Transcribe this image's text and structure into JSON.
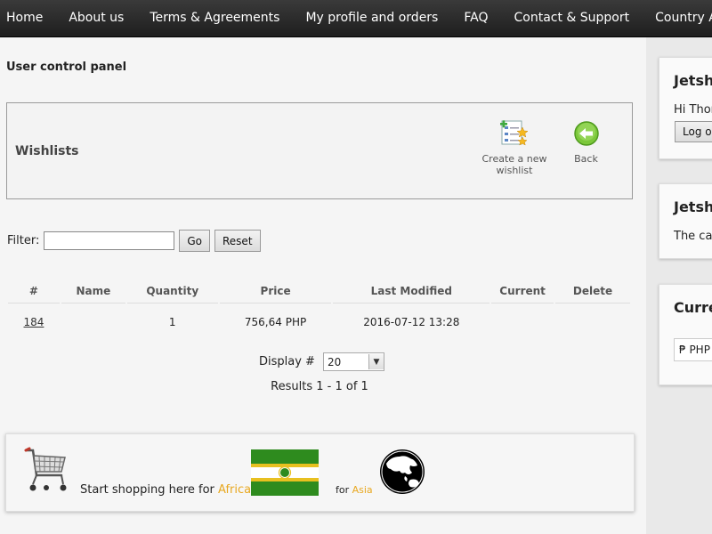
{
  "nav": {
    "items": [
      {
        "label": "Home"
      },
      {
        "label": "About us"
      },
      {
        "label": "Terms & Agreements"
      },
      {
        "label": "My profile and orders"
      },
      {
        "label": "FAQ"
      },
      {
        "label": "Contact & Support"
      },
      {
        "label": "Country Agents"
      }
    ]
  },
  "panel": {
    "title": "User control panel"
  },
  "wishlists": {
    "title": "Wishlists",
    "create_label": "Create a new wishlist",
    "back_label": "Back"
  },
  "filter": {
    "label": "Filter:",
    "value": "",
    "go_label": "Go",
    "reset_label": "Reset"
  },
  "table": {
    "headers": [
      "#",
      "Name",
      "Quantity",
      "Price",
      "Last Modified",
      "Current",
      "Delete"
    ],
    "rows": [
      {
        "id": "184",
        "name": "",
        "quantity": "1",
        "price": "756,64 PHP",
        "modified": "2016-07-12 13:28",
        "current": "",
        "delete": ""
      }
    ]
  },
  "pagination": {
    "display_label": "Display #",
    "display_value": "20",
    "results": "Results 1 - 1 of 1"
  },
  "shop": {
    "start_text": "Start shopping here for",
    "africa_link": "Africa",
    "for_text": "for",
    "asia_link": "Asia"
  },
  "sidebar": {
    "box1_title": "Jetsho",
    "box1_greeting": "Hi Thom",
    "logout_label": "Log ou",
    "box2_title": "Jetsho",
    "box2_text": "The ca",
    "box3_title": "Curre",
    "currency_value": "₱ PHP"
  },
  "colors": {
    "link_accent": "#e8a820",
    "nav_bg": "#2a2a2a"
  }
}
